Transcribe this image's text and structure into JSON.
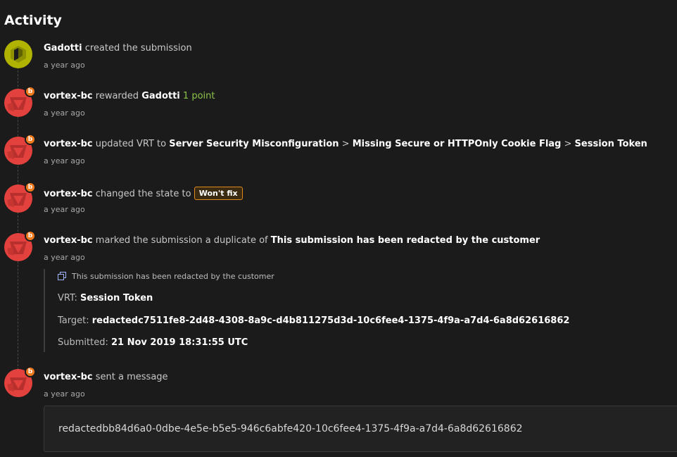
{
  "title": "Activity",
  "colors": {
    "gadotti_avatar": "#b0b400",
    "vortex_avatar": "#e3413d",
    "badge": "#f07b1f",
    "points": "#8bc34a",
    "state_border": "#e08a1e"
  },
  "entries": [
    {
      "actor": "Gadotti",
      "action": "created the submission",
      "time": "a year ago",
      "avatar_icon": "cube-avatar-icon"
    },
    {
      "actor": "vortex-bc",
      "action": "rewarded",
      "target": "Gadotti",
      "points": "1 point",
      "time": "a year ago",
      "badge": "b"
    },
    {
      "actor": "vortex-bc",
      "action": "updated VRT to",
      "vrt": [
        "Server Security Misconfiguration",
        "Missing Secure or HTTPOnly Cookie Flag",
        "Session Token"
      ],
      "separator": ">",
      "time": "a year ago",
      "badge": "b"
    },
    {
      "actor": "vortex-bc",
      "action": "changed the state to",
      "state": "Won't fix",
      "time": "a year ago",
      "badge": "b"
    },
    {
      "actor": "vortex-bc",
      "action": "marked the submission a duplicate of",
      "target": "This submission has been redacted by the customer",
      "time": "a year ago",
      "badge": "b",
      "duplicate": {
        "heading": "This submission has been redacted by the customer",
        "vrt_label": "VRT:",
        "vrt_value": "Session Token",
        "target_label": "Target:",
        "target_value": "redactedc7511fe8-2d48-4308-8a9c-d4b811275d3d-10c6fee4-1375-4f9a-a7d4-6a8d62616862",
        "submitted_label": "Submitted:",
        "submitted_value": "21 Nov 2019 18:31:55 UTC"
      }
    },
    {
      "actor": "vortex-bc",
      "action": "sent a message",
      "time": "a year ago",
      "badge": "b",
      "message": "redactedbb84d6a0-0dbe-4e5e-b5e5-946c6abfe420-10c6fee4-1375-4f9a-a7d4-6a8d62616862"
    }
  ]
}
